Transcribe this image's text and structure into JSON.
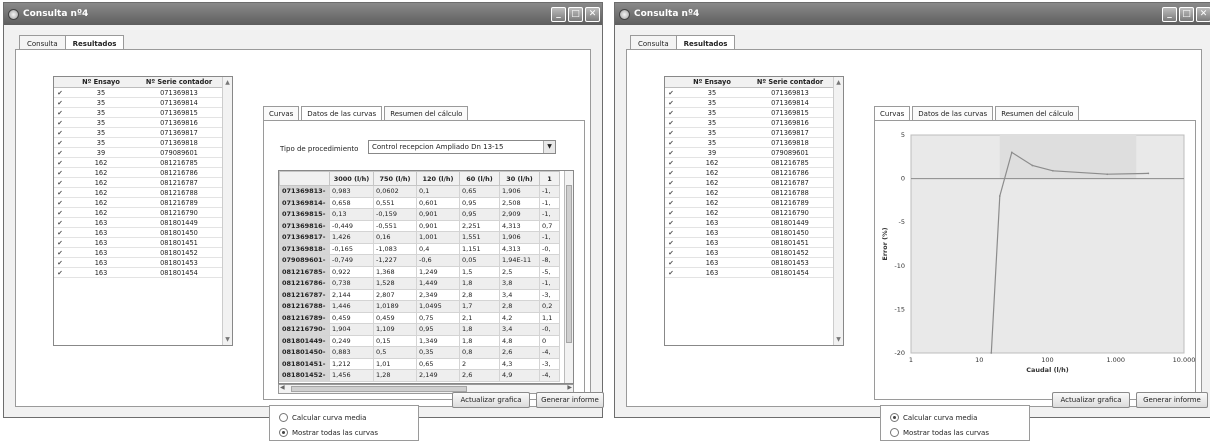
{
  "windows": [
    {
      "title": "Consulta nº4",
      "tabs": [
        "Consulta",
        "Resultados"
      ],
      "active_tab": "Resultados",
      "subtabs": [
        "Curvas",
        "Datos de las curvas",
        "Resumen del cálculo"
      ],
      "active_subtab": "Datos de las curvas"
    },
    {
      "title": "Consulta nº4",
      "tabs": [
        "Consulta",
        "Resultados"
      ],
      "active_tab": "Resultados",
      "subtabs": [
        "Curvas",
        "Datos de las curvas",
        "Resumen del cálculo"
      ],
      "active_subtab": "Curvas"
    }
  ],
  "list": {
    "headers": [
      "Nº Ensayo",
      "Nº Serie contador"
    ],
    "rows": [
      [
        "35",
        "071369813"
      ],
      [
        "35",
        "071369814"
      ],
      [
        "35",
        "071369815"
      ],
      [
        "35",
        "071369816"
      ],
      [
        "35",
        "071369817"
      ],
      [
        "35",
        "071369818"
      ],
      [
        "39",
        "079089601"
      ],
      [
        "162",
        "081216785"
      ],
      [
        "162",
        "081216786"
      ],
      [
        "162",
        "081216787"
      ],
      [
        "162",
        "081216788"
      ],
      [
        "162",
        "081216789"
      ],
      [
        "162",
        "081216790"
      ],
      [
        "163",
        "081801449"
      ],
      [
        "163",
        "081801450"
      ],
      [
        "163",
        "081801451"
      ],
      [
        "163",
        "081801452"
      ],
      [
        "163",
        "081801453"
      ],
      [
        "163",
        "081801454"
      ]
    ]
  },
  "procedure": {
    "label": "Tipo de procedimiento",
    "value": "Control recepcion Ampliado Dn 13-15"
  },
  "data_grid": {
    "headers": [
      "",
      "3000 (l/h)",
      "750 (l/h)",
      "120 (l/h)",
      "60 (l/h)",
      "30 (l/h)",
      "1"
    ],
    "rows": [
      [
        "071369813-",
        "0,983",
        "0,0602",
        "0,1",
        "0,65",
        "1,906",
        "-1,"
      ],
      [
        "071369814-",
        "0,658",
        "0,551",
        "0,601",
        "0,95",
        "2,508",
        "-1,"
      ],
      [
        "071369815-",
        "0,13",
        "-0,159",
        "0,901",
        "0,95",
        "2,909",
        "-1,"
      ],
      [
        "071369816-",
        "-0,449",
        "-0,551",
        "0,901",
        "2,251",
        "4,313",
        "0,7"
      ],
      [
        "071369817-",
        "1,426",
        "0,16",
        "1,001",
        "1,551",
        "1,906",
        "-1,"
      ],
      [
        "071369818-",
        "-0,165",
        "-1,083",
        "0,4",
        "1,151",
        "4,313",
        "-0,"
      ],
      [
        "079089601-",
        "-0,749",
        "-1,227",
        "-0,6",
        "0,05",
        "1,94E-11",
        "-8,"
      ],
      [
        "081216785-",
        "0,922",
        "1,368",
        "1,249",
        "1,5",
        "2,5",
        "-5,"
      ],
      [
        "081216786-",
        "0,738",
        "1,528",
        "1,449",
        "1,8",
        "3,8",
        "-1,"
      ],
      [
        "081216787-",
        "2,144",
        "2,807",
        "2,349",
        "2,8",
        "3,4",
        "-3,"
      ],
      [
        "081216788-",
        "1,446",
        "1,0189",
        "1,0495",
        "1,7",
        "2,8",
        "0,2"
      ],
      [
        "081216789-",
        "0,459",
        "0,459",
        "0,75",
        "2,1",
        "4,2",
        "1,1"
      ],
      [
        "081216790-",
        "1,904",
        "1,109",
        "0,95",
        "1,8",
        "3,4",
        "-0,"
      ],
      [
        "081801449-",
        "0,249",
        "0,15",
        "1,349",
        "1,8",
        "4,8",
        "0"
      ],
      [
        "081801450-",
        "0,883",
        "0,5",
        "0,35",
        "0,8",
        "2,6",
        "-4,"
      ],
      [
        "081801451-",
        "1,212",
        "1,01",
        "0,65",
        "2",
        "4,3",
        "-3,"
      ],
      [
        "081801452-",
        "1,456",
        "1,28",
        "2,149",
        "2,6",
        "4,9",
        "-4,"
      ]
    ]
  },
  "options": {
    "calcular": "Calcular curva media",
    "mostrar": "Mostrar todas las curvas"
  },
  "buttons": {
    "actualizar": "Actualizar grafica",
    "generar": "Generar informe"
  },
  "chart_data": {
    "type": "line",
    "xscale": "log",
    "xlabel": "Caudal (l/h)",
    "ylabel": "Error (%)",
    "xlim": [
      1,
      10000
    ],
    "ylim": [
      -20,
      5
    ],
    "xticks": [
      1,
      10,
      100,
      1000,
      10000
    ],
    "xtick_labels": [
      "1",
      "10",
      "100",
      "1.000",
      "10.000"
    ],
    "yticks": [
      5,
      0,
      -5,
      -10,
      -15,
      -20
    ],
    "ytick_labels": [
      "5",
      "0",
      "-5",
      "-10",
      "-15",
      "-20"
    ],
    "series": [
      {
        "x": [
          15,
          20,
          30,
          60,
          120,
          750,
          3000
        ],
        "y": [
          -20,
          -2,
          3,
          1.5,
          0.9,
          0.5,
          0.6
        ]
      }
    ]
  }
}
